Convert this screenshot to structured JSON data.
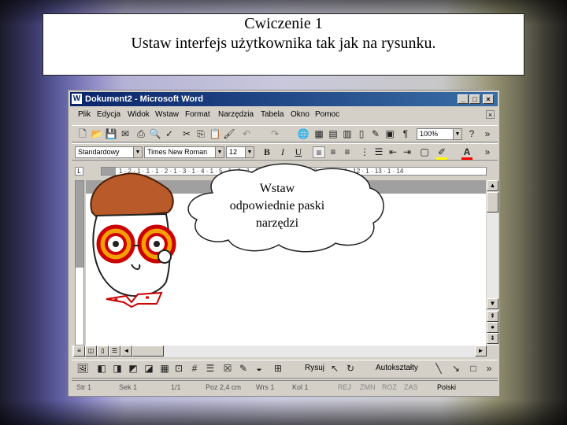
{
  "slide": {
    "title": "Cwiczenie 1",
    "subtitle": "Ustaw interfejs użytkownika tak jak na rysunku."
  },
  "window": {
    "title": "Dokument2 - Microsoft Word",
    "buttons": [
      "minimize",
      "maximize",
      "close"
    ]
  },
  "menu": [
    "Plik",
    "Edycja",
    "Widok",
    "Wstaw",
    "Format",
    "Narzędzia",
    "Tabela",
    "Okno",
    "Pomoc"
  ],
  "standard_toolbar": {
    "icons": [
      "new-icon",
      "open-icon",
      "save-icon",
      "email-icon",
      "print-icon",
      "print-preview-icon",
      "spelling-icon",
      "cut-icon",
      "copy-icon",
      "paste-icon",
      "format-painter-icon",
      "undo-icon",
      "redo-icon",
      "hyperlink-icon",
      "tables-borders-icon",
      "insert-table-icon",
      "insert-excel-icon",
      "columns-icon",
      "drawing-icon",
      "document-map-icon",
      "show-hide-icon"
    ],
    "zoom": "100%"
  },
  "formatting_toolbar": {
    "style": "Standardowy",
    "font": "Times New Roman",
    "size": "12",
    "bold": "B",
    "italic": "I",
    "underline": "U"
  },
  "ruler": {
    "labels": "1 · 2 · 1 · 1 · 1 · 2 · 1 · 3 · 1 · 4 · 1 · 5 · 1 · 6 · 1 · 7 · 1 · 8 · 1 · 9 · 1 · 10 · 1 · 11 · 1 · 12 · 1 · 13 · 1 · 14"
  },
  "callout": {
    "text_line1": "Wstaw",
    "text_line2": "odpowiednie paski",
    "text_line3": "narzędzi"
  },
  "drawing_toolbar": {
    "draw_label": "Rysuj",
    "autoshapes_label": "Autokształty"
  },
  "status_bar": {
    "page": "Str 1",
    "section": "Sek 1",
    "pages": "1/1",
    "position": "Poz 2,4 cm",
    "line": "Wrs 1",
    "column": "Kol 1",
    "rec": "REJ",
    "trk": "ZMN",
    "ext": "ROZ",
    "ovr": "ZAS",
    "language": "Polski"
  },
  "colors": {
    "titlebar_start": "#0a246a",
    "titlebar_end": "#3a6ea5",
    "chrome": "#d4d0c8",
    "font_color_swatch": "#ff0000",
    "highlight_swatch": "#ffff00"
  }
}
